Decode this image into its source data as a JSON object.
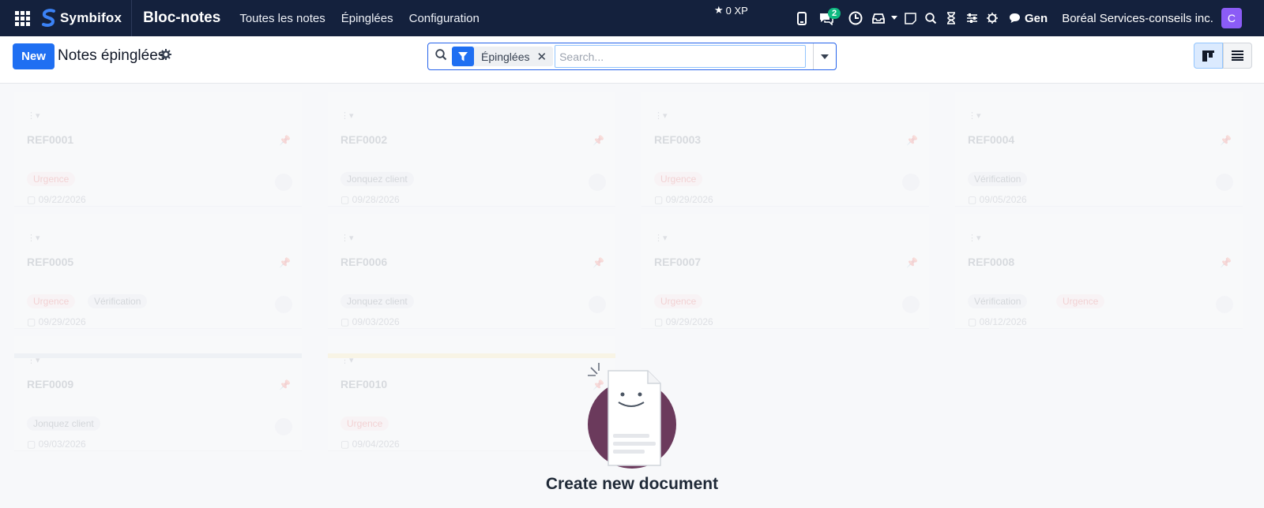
{
  "navbar": {
    "brand": "Symbifox",
    "app_name": "Bloc-notes",
    "menu": [
      "Toutes les notes",
      "Épinglées",
      "Configuration"
    ],
    "xp": "0 XP",
    "chat_badge": "2",
    "user_label": "Gen",
    "company": "Boréal Services-conseils inc.",
    "avatar_initial": "C",
    "icons": [
      "apps-grid-icon",
      "phone-icon",
      "chat-icon",
      "clock-icon",
      "inbox-icon",
      "caret-icon",
      "note-icon",
      "search-icon",
      "hourglass-icon",
      "sliders-icon",
      "bug-icon",
      "message-icon"
    ]
  },
  "control": {
    "new_label": "New",
    "title": "Notes épinglées",
    "search_placeholder": "Search...",
    "facet_label": "Épinglées"
  },
  "ghost_cards": [
    {
      "ref": "REF0001",
      "tags": [
        {
          "text": "Urgence",
          "color": "red"
        }
      ],
      "date": "09/22/2026"
    },
    {
      "ref": "REF0002",
      "tags": [
        {
          "text": "Jonquez client",
          "color": "gray"
        }
      ],
      "date": "09/28/2026"
    },
    {
      "ref": "REF0003",
      "tags": [
        {
          "text": "Urgence",
          "color": "red"
        }
      ],
      "date": "09/29/2026"
    },
    {
      "ref": "REF0004",
      "tags": [
        {
          "text": "Vérification",
          "color": "gray"
        }
      ],
      "date": "09/05/2026"
    },
    {
      "ref": "REF0005",
      "tags": [
        {
          "text": "Urgence",
          "color": "red"
        },
        {
          "text": "Vérification",
          "color": "gray"
        }
      ],
      "date": "09/29/2026"
    },
    {
      "ref": "REF0006",
      "tags": [
        {
          "text": "Jonquez client",
          "color": "gray"
        }
      ],
      "date": "09/03/2026"
    },
    {
      "ref": "REF0007",
      "tags": [
        {
          "text": "Urgence",
          "color": "red"
        }
      ],
      "date": "09/29/2026"
    },
    {
      "ref": "REF0008",
      "tags": [
        {
          "text": "Vérification",
          "color": "gray"
        },
        {
          "text": "Urgence",
          "color": "red"
        }
      ],
      "date": "08/12/2026"
    },
    {
      "ref": "REF0009",
      "tags": [
        {
          "text": "Jonquez client",
          "color": "gray"
        }
      ],
      "date": "09/03/2026"
    },
    {
      "ref": "REF0010",
      "tags": [
        {
          "text": "Urgence",
          "color": "red"
        }
      ],
      "date": "09/04/2026"
    }
  ],
  "empty": {
    "title": "Create new document"
  },
  "colors": {
    "navbar": "#14213d",
    "primary": "#1f6ff2",
    "avatar": "#8b5cf6",
    "badge": "#10b981",
    "illustration": "#6b3a5c"
  }
}
